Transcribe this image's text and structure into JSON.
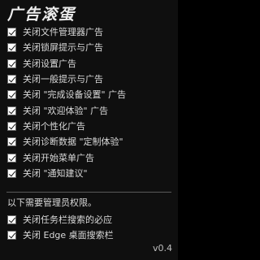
{
  "app": {
    "title": "广告滚蛋",
    "version": "v0.4"
  },
  "options": [
    {
      "label": "关闭文件管理器广告",
      "checked": true
    },
    {
      "label": "关闭锁屏提示与广告",
      "checked": true
    },
    {
      "label": "关闭设置广告",
      "checked": true
    },
    {
      "label": "关闭一般提示与广告",
      "checked": true
    },
    {
      "label": "关闭 \"完成设备设置\" 广告",
      "checked": true
    },
    {
      "label": "关闭 \"欢迎体验\" 广告",
      "checked": true
    },
    {
      "label": "关闭个性化广告",
      "checked": true
    },
    {
      "label": "关闭诊断数据 \"定制体验\"",
      "checked": true
    },
    {
      "label": "关闭开始菜单广告",
      "checked": true
    },
    {
      "label": "关闭 \"通知建议\"",
      "checked": true
    }
  ],
  "admin_section": {
    "note": "以下需要管理员权限。",
    "options": [
      {
        "label": "关闭任务栏搜索的必应",
        "checked": true
      },
      {
        "label": "关闭 Edge 桌面搜索栏",
        "checked": true
      }
    ]
  }
}
